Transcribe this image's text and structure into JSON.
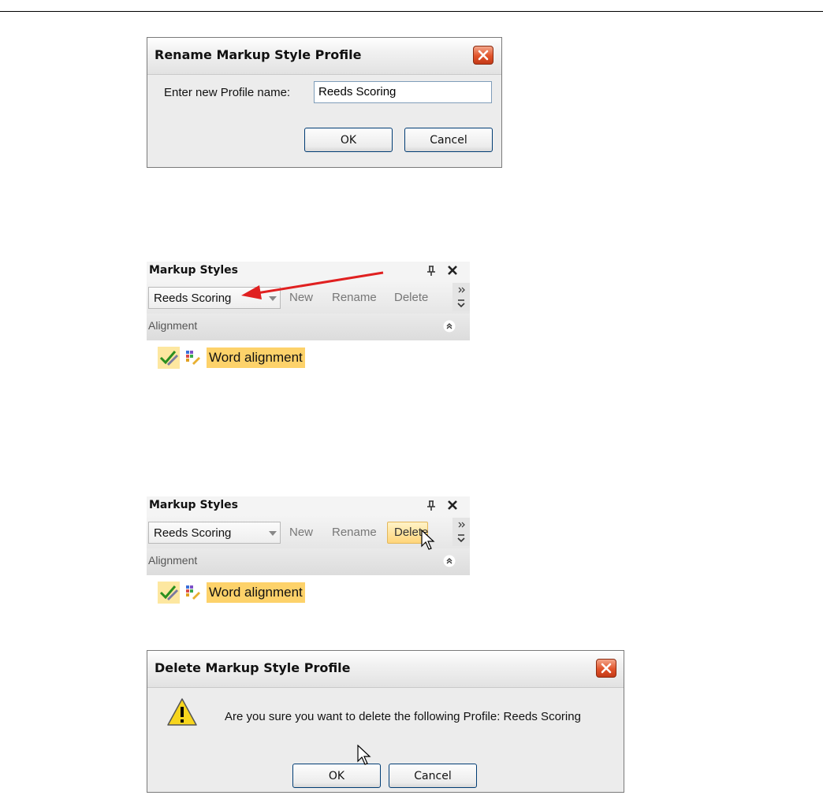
{
  "rename_dialog": {
    "title": "Rename Markup Style Profile",
    "prompt": "Enter new Profile name:",
    "name_value": "Reeds Scoring",
    "ok_label": "OK",
    "cancel_label": "Cancel"
  },
  "pane_1": {
    "title": "Markup Styles",
    "profile_value": "Reeds Scoring",
    "new_label": "New",
    "rename_label": "Rename",
    "delete_label": "Delete",
    "group_label": "Alignment",
    "item_label": "Word alignment"
  },
  "pane_2": {
    "title": "Markup Styles",
    "profile_value": "Reeds Scoring",
    "new_label": "New",
    "rename_label": "Rename",
    "delete_label": "Delete",
    "group_label": "Alignment",
    "item_label": "Word alignment"
  },
  "delete_dialog": {
    "title": "Delete Markup Style Profile",
    "message": "Are you sure you want to delete the following Profile: Reeds Scoring",
    "ok_label": "OK",
    "cancel_label": "Cancel"
  },
  "colors": {
    "arrow_annotation": "#e02020",
    "highlight": "#fdd26a",
    "close_button": "#e1532a"
  },
  "icons": [
    "close-icon",
    "pin-icon",
    "chevron-up-icon",
    "checkmark-pencil-icon",
    "style-palette-icon",
    "warning-icon",
    "mouse-cursor-icon"
  ]
}
